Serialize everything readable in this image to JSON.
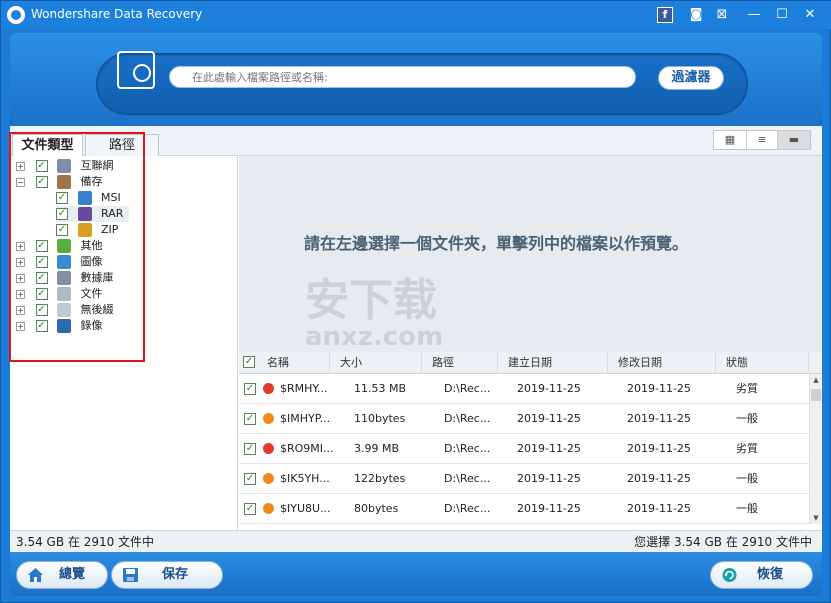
{
  "window": {
    "title": "Wondershare Data Recovery",
    "controls": [
      "f",
      "◙",
      "⊠",
      "—",
      "☐",
      "✕"
    ]
  },
  "search": {
    "placeholder": "在此處輸入檔案路徑或名稱:",
    "filter_label": "過濾器"
  },
  "tabs": [
    {
      "label": "文件類型",
      "active": true
    },
    {
      "label": "路徑",
      "active": false
    }
  ],
  "views": [
    "▦",
    "≡",
    "▬"
  ],
  "tree": [
    {
      "label": "互聯網",
      "expander": "+",
      "color": "#7a8ea8"
    },
    {
      "label": "備存",
      "expander": "−",
      "color": "#a0744a"
    },
    {
      "label": "MSI",
      "color": "#3a7fd0",
      "child": true
    },
    {
      "label": "RAR",
      "color": "#6a4aa0",
      "child": true,
      "selected": true
    },
    {
      "label": "ZIP",
      "color": "#d8a020",
      "child": true
    },
    {
      "label": "其他",
      "expander": "+",
      "color": "#5cae3a"
    },
    {
      "label": "圖像",
      "expander": "+",
      "color": "#3a8ad0"
    },
    {
      "label": "數據庫",
      "expander": "+",
      "color": "#8090a0"
    },
    {
      "label": "文件",
      "expander": "+",
      "color": "#b0b8c0"
    },
    {
      "label": "無後綴",
      "expander": "+",
      "color": "#c0c8d0"
    },
    {
      "label": "錄像",
      "expander": "+",
      "color": "#2a6ab0"
    }
  ],
  "preview": {
    "message": "請在左邊選擇一個文件夾，單擊列中的檔案以作預覽。",
    "watermark_main": "安下载",
    "watermark_sub": "anxz.com"
  },
  "table": {
    "columns": [
      "名稱",
      "大小",
      "路徑",
      "建立日期",
      "修改日期",
      "狀態"
    ],
    "rows": [
      {
        "name": "$RMHY...",
        "size": "11.53 MB",
        "path": "D:\\Rec...",
        "created": "2019-11-25",
        "modified": "2019-11-25",
        "status": "劣質",
        "dot": "#e33b2e"
      },
      {
        "name": "$IMHYP...",
        "size": "110bytes",
        "path": "D:\\Rec...",
        "created": "2019-11-25",
        "modified": "2019-11-25",
        "status": "一般",
        "dot": "#f08a1c"
      },
      {
        "name": "$RO9MI...",
        "size": "3.99 MB",
        "path": "D:\\Rec...",
        "created": "2019-11-25",
        "modified": "2019-11-25",
        "status": "劣質",
        "dot": "#e33b2e"
      },
      {
        "name": "$IK5YH...",
        "size": "122bytes",
        "path": "D:\\Rec...",
        "created": "2019-11-25",
        "modified": "2019-11-25",
        "status": "一般",
        "dot": "#f08a1c"
      },
      {
        "name": "$IYU8U...",
        "size": "80bytes",
        "path": "D:\\Rec...",
        "created": "2019-11-25",
        "modified": "2019-11-25",
        "status": "一般",
        "dot": "#f08a1c"
      }
    ]
  },
  "status": {
    "left": "3.54 GB 在 2910 文件中",
    "right": "您選擇 3.54 GB 在 2910 文件中"
  },
  "footer": {
    "home_label": "總覽",
    "save_label": "保存",
    "recover_label": "恢復"
  }
}
